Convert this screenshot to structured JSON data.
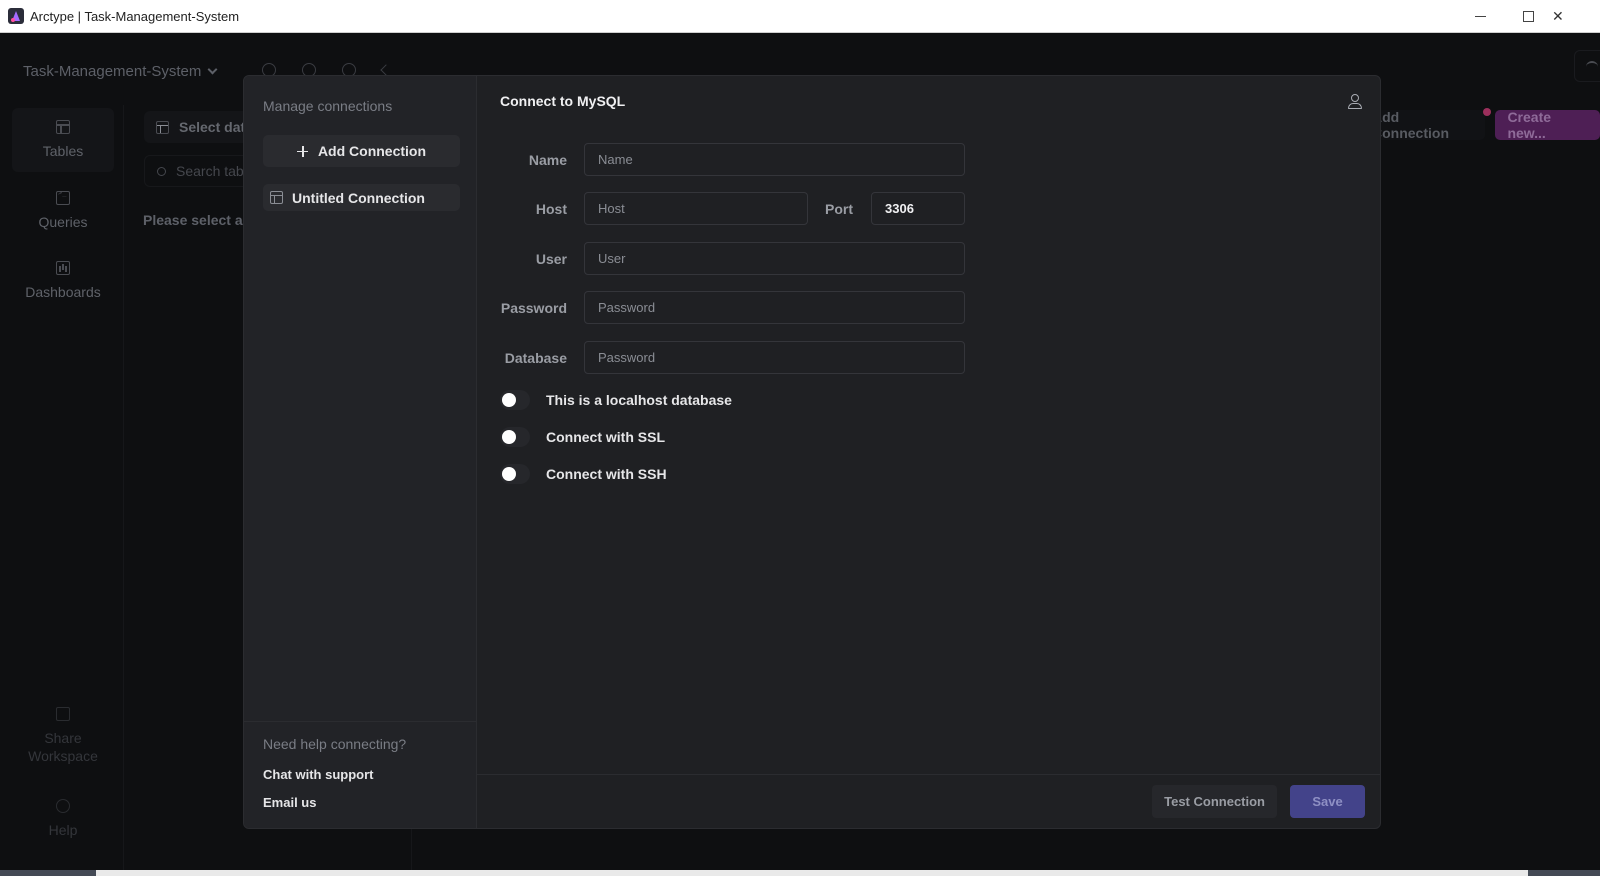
{
  "window": {
    "title": "Arctype | Task-Management-System",
    "minimize_icon": "minimize-icon",
    "maximize_icon": "maximize-icon",
    "close_icon": "close-icon"
  },
  "background": {
    "workspace_name": "Task-Management-System",
    "rail": [
      {
        "label": "Tables",
        "icon": "table-icon",
        "active": true
      },
      {
        "label": "Queries",
        "icon": "terminal-icon",
        "active": false
      },
      {
        "label": "Dashboards",
        "icon": "bar-chart-icon",
        "active": false
      }
    ],
    "rail_bottom": [
      {
        "label": "Share Workspace",
        "icon": "external-link-icon"
      },
      {
        "label": "Help",
        "icon": "help-circle-icon"
      }
    ],
    "select_database": "Select dat",
    "search_tables_placeholder": "Search tab",
    "please_select": "Please select a",
    "add_connection": "Add Connection",
    "create_new": "Create new..."
  },
  "modal": {
    "sidebar": {
      "title": "Manage connections",
      "add_connection": "Add Connection",
      "connections": [
        {
          "label": "Untitled Connection",
          "selected": true
        }
      ],
      "help_title": "Need help connecting?",
      "chat_support": "Chat with support",
      "email_us": "Email us"
    },
    "title": "Connect to MySQL",
    "form": {
      "name": {
        "label": "Name",
        "placeholder": "Name",
        "value": ""
      },
      "host": {
        "label": "Host",
        "placeholder": "Host",
        "value": ""
      },
      "port": {
        "label": "Port",
        "value": "3306"
      },
      "user": {
        "label": "User",
        "placeholder": "User",
        "value": ""
      },
      "password": {
        "label": "Password",
        "placeholder": "Password",
        "value": ""
      },
      "database": {
        "label": "Database",
        "placeholder": "Password",
        "value": ""
      }
    },
    "toggles": [
      {
        "label": "This is a localhost database",
        "on": false
      },
      {
        "label": "Connect with SSL",
        "on": false
      },
      {
        "label": "Connect with SSH",
        "on": false
      }
    ],
    "footer": {
      "test_connection": "Test Connection",
      "save": "Save"
    }
  },
  "colors": {
    "save_button": "#43438a",
    "create_new_button": "#4e1f55",
    "notification_dot": "#9c2f5c"
  }
}
